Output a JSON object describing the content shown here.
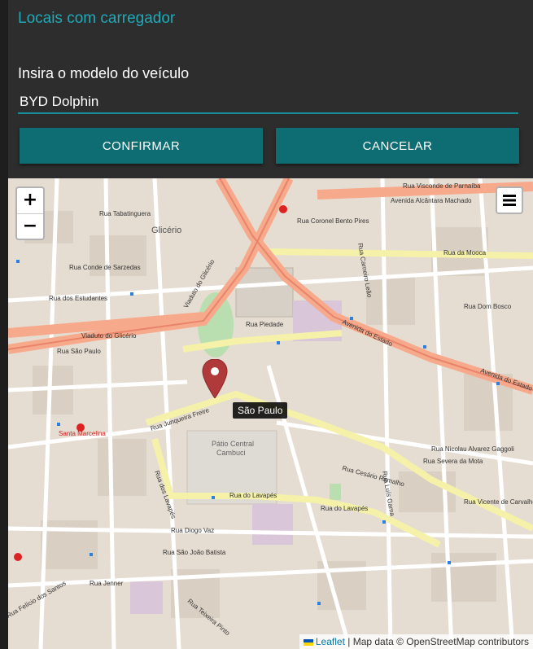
{
  "dialog": {
    "title": "Locais com carregador",
    "field_label": "Insira o modelo do veículo",
    "field_value": "BYD Dolphin",
    "confirm_label": "CONFIRMAR",
    "cancel_label": "CANCELAR"
  },
  "map": {
    "zoom_in": "+",
    "zoom_out": "−",
    "marker_tooltip": "São Paulo",
    "attribution": {
      "leaflet": "Leaflet",
      "separator": " | ",
      "text": "Map data © OpenStreetMap contributors"
    },
    "labels": {
      "glicerio": "Glicério",
      "patio": "Pátio Central",
      "cambuci": "Cambuci",
      "santa": "Santa Marcelina",
      "viaduto_glicerio": "Viaduto do Glicério",
      "viaduto_glicerio2": "Viaduto do Glicério",
      "av_estado": "Avenida do Estado",
      "av_estado2": "Avenida do Estado",
      "av_alcantara": "Avenida Alcântara Machado",
      "rua_mooca": "Rua da Mooca",
      "rua_lavapes": "Rua do Lavapés",
      "rua_lavapes2": "Rua dos Lavapés",
      "rua_lavapes3": "Rua do Lavapés",
      "rua_junqueira": "Rua Junqueira Freire",
      "rua_tabatinguera": "Rua Tabatinguera",
      "rua_piedade": "Rua Piedade",
      "rua_conde": "Rua Conde de Sarzedas",
      "rua_estudantes": "Rua dos Estudantes",
      "rua_sao_paulo": "Rua São Paulo",
      "rua_diogo_vaz": "Rua Diogo Vaz",
      "rua_joao_batista": "Rua São João Batista",
      "rua_cesario": "Rua Cesário Ramalho",
      "rua_nicolau": "Rua Nicolau Alvarez Gaggoli",
      "rua_severa": "Rua Severa da Mota",
      "rua_teixeira": "Rua Teixeira Pinto",
      "rua_jenner": "Rua Jenner",
      "rua_felicio": "Rua Felício dos Santos",
      "rua_visconde": "Rua Visconde de Parnaíba",
      "rua_coronel": "Rua Coronel Bento Pires",
      "rua_dom_bosco": "Rua Dom Bosco",
      "rua_vicente": "Rua Vicente de Carvalho",
      "rua_luis_gama": "Rua Luís Gama",
      "rua_carneiro": "Rua Carneiro Leão"
    }
  }
}
